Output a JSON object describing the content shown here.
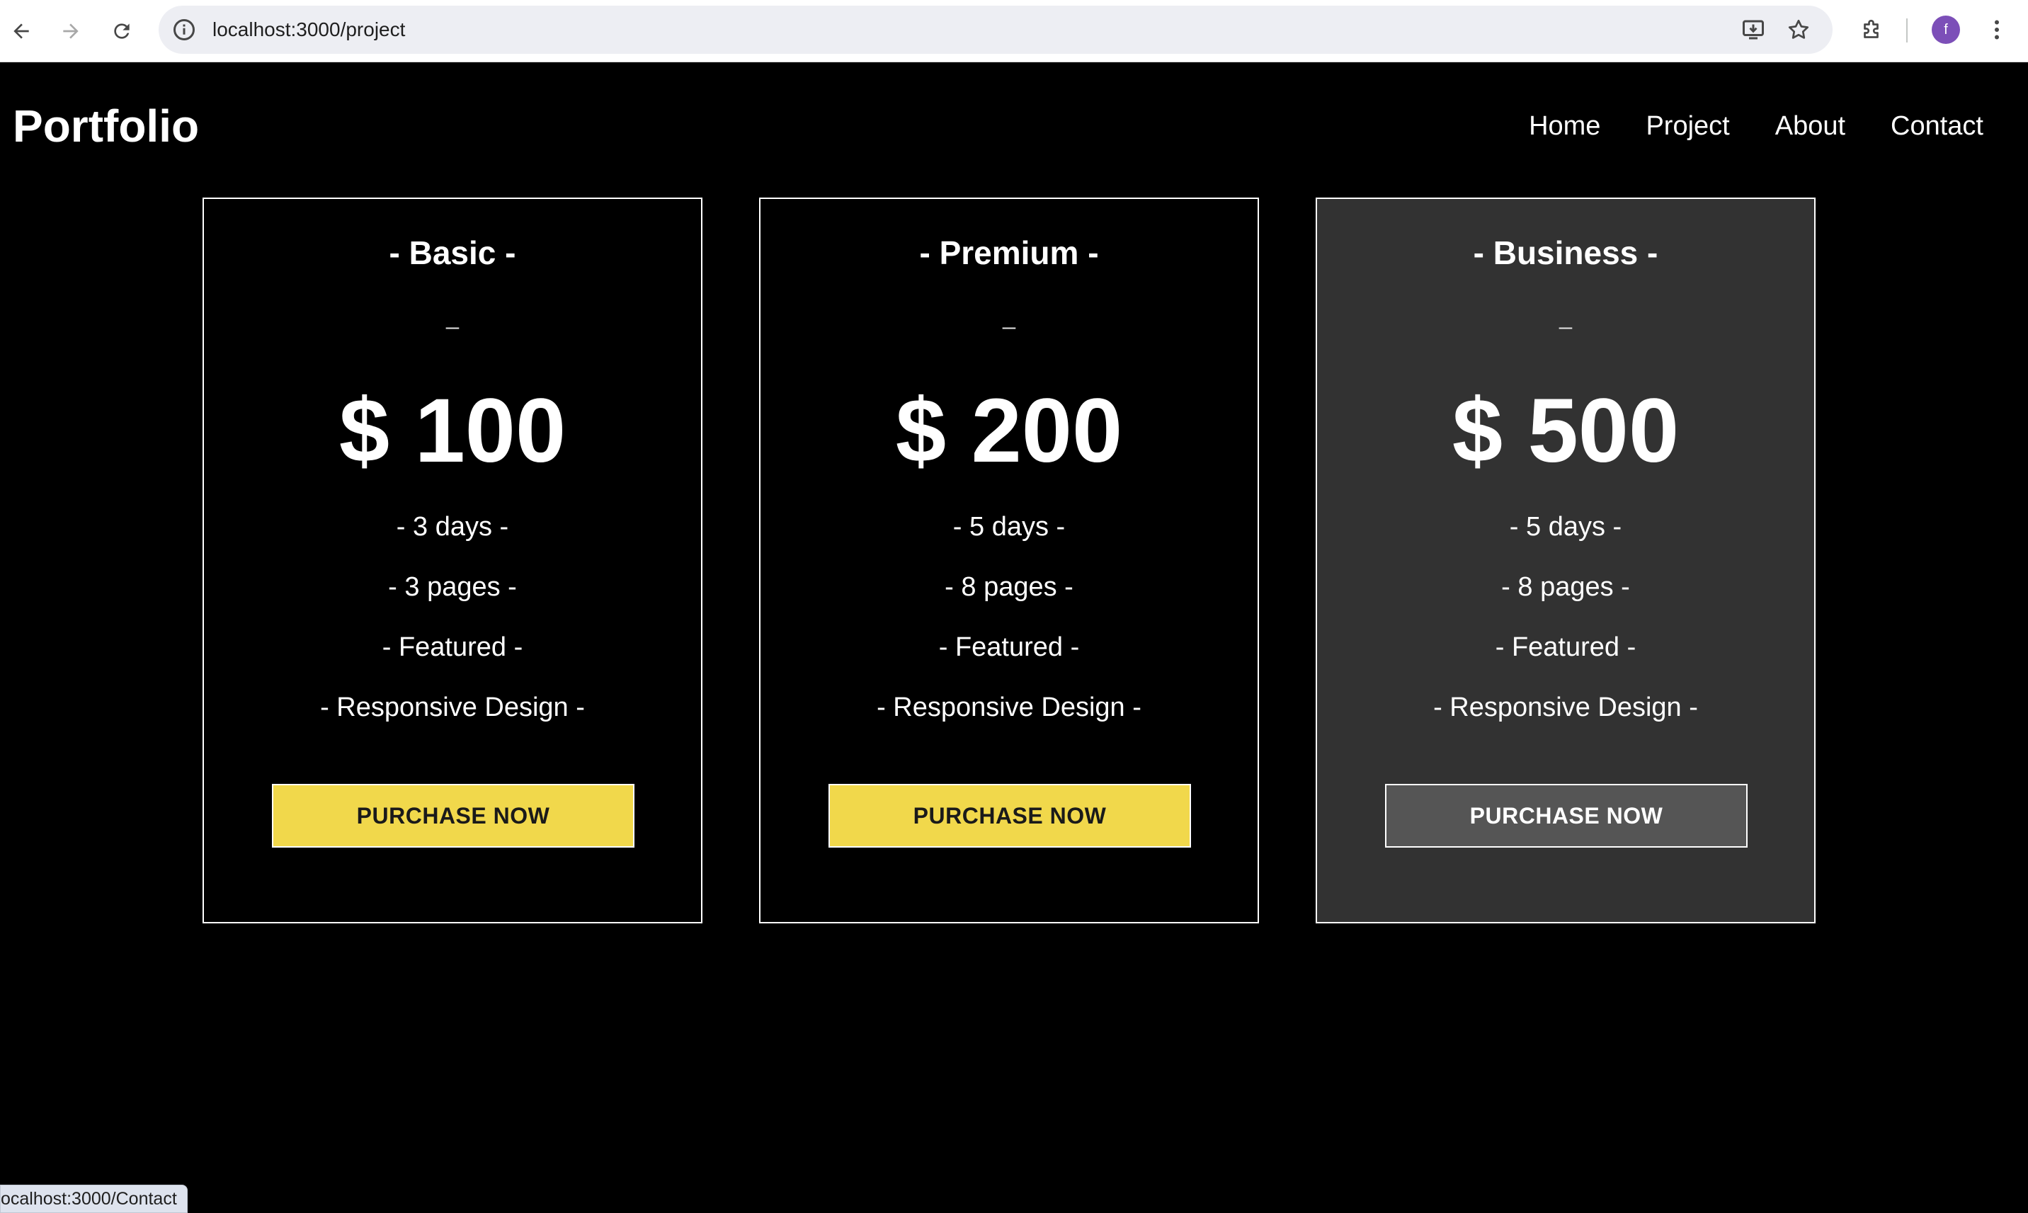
{
  "browser": {
    "url": "localhost:3000/project",
    "avatar_letter": "f",
    "status_url": "ocalhost:3000/Contact",
    "icons": {
      "back": "arrow-left-icon",
      "forward": "arrow-right-icon",
      "reload": "reload-icon",
      "site_info": "info-circle-icon",
      "install": "install-app-icon",
      "bookmark": "star-icon",
      "extensions": "puzzle-icon",
      "menu": "kebab-menu-icon"
    }
  },
  "site": {
    "brand": "Portfolio",
    "nav": [
      {
        "label": "Home"
      },
      {
        "label": "Project"
      },
      {
        "label": "About"
      },
      {
        "label": "Contact"
      }
    ]
  },
  "plans": [
    {
      "title": "- Basic -",
      "dash": "_",
      "price": "$ 100",
      "features": [
        "- 3 days -",
        "- 3 pages -",
        "- Featured -",
        "- Responsive Design -"
      ],
      "button": "PURCHASE NOW"
    },
    {
      "title": "- Premium -",
      "dash": "_",
      "price": "$ 200",
      "features": [
        "- 5 days -",
        "- 8 pages -",
        "- Featured -",
        "- Responsive Design -"
      ],
      "button": "PURCHASE NOW"
    },
    {
      "title": "- Business -",
      "dash": "_",
      "price": "$ 500",
      "features": [
        "- 5 days -",
        "- 8 pages -",
        "- Featured -",
        "- Responsive Design -"
      ],
      "button": "PURCHASE NOW"
    }
  ],
  "colors": {
    "page_bg": "#000000",
    "accent_button": "#f1d84b",
    "highlight_card_bg": "#323232",
    "highlight_button": "#555555"
  }
}
